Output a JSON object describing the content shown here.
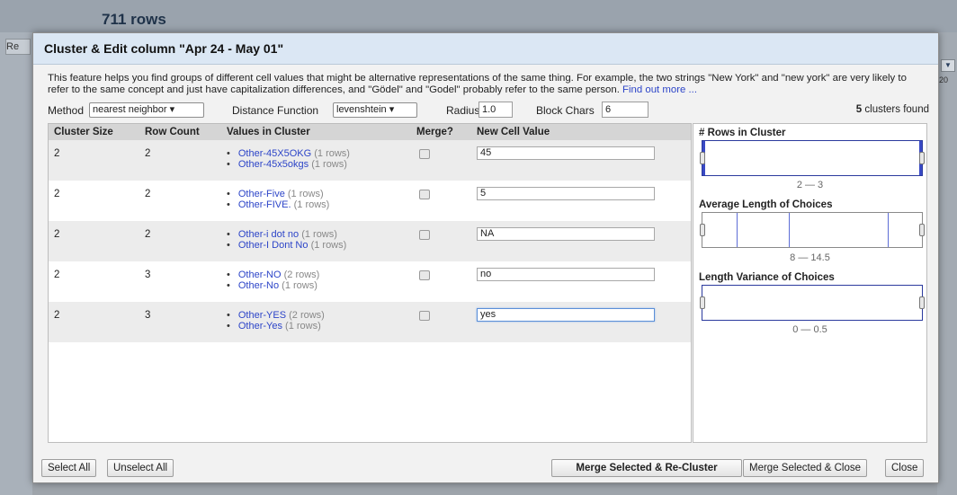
{
  "background": {
    "rows_label": "711 rows",
    "left_button_label": "Re",
    "right_label": "20"
  },
  "dialog": {
    "title": "Cluster & Edit column \"Apr 24 - May 01\"",
    "description": "This feature helps you find groups of different cell values that might be alternative representations of the same thing. For example, the two strings \"New York\" and \"new york\" are very likely to refer to the same concept and just have capitalization differences, and \"Gödel\" and \"Godel\" probably refer to the same person.",
    "find_out_more": "Find out more ...",
    "controls": {
      "method_label": "Method",
      "method_value": "nearest neighbor",
      "distance_label": "Distance Function",
      "distance_value": "levenshtein",
      "radius_label": "Radius",
      "radius_value": "1.0",
      "block_label": "Block Chars",
      "block_value": "6",
      "clusters_count": "5",
      "clusters_found": "clusters found"
    },
    "table": {
      "headers": [
        "Cluster Size",
        "Row Count",
        "Values in Cluster",
        "Merge?",
        "New Cell Value"
      ],
      "rows": [
        {
          "size": "2",
          "count": "2",
          "values": [
            {
              "v": "Other-45X5OKG",
              "rc": "(1 rows)"
            },
            {
              "v": "Other-45x5okgs",
              "rc": "(1 rows)"
            }
          ],
          "merge": false,
          "new_value": "45"
        },
        {
          "size": "2",
          "count": "2",
          "values": [
            {
              "v": "Other-Five",
              "rc": "(1 rows)"
            },
            {
              "v": "Other-FIVE.",
              "rc": "(1 rows)"
            }
          ],
          "merge": false,
          "new_value": "5"
        },
        {
          "size": "2",
          "count": "2",
          "values": [
            {
              "v": "Other-i dot no",
              "rc": "(1 rows)"
            },
            {
              "v": "Other-I Dont No",
              "rc": "(1 rows)"
            }
          ],
          "merge": false,
          "new_value": "NA"
        },
        {
          "size": "2",
          "count": "3",
          "values": [
            {
              "v": "Other-NO",
              "rc": "(2 rows)"
            },
            {
              "v": "Other-No",
              "rc": "(1 rows)"
            }
          ],
          "merge": false,
          "new_value": "no"
        },
        {
          "size": "2",
          "count": "3",
          "values": [
            {
              "v": "Other-YES",
              "rc": "(2 rows)"
            },
            {
              "v": "Other-Yes",
              "rc": "(1 rows)"
            }
          ],
          "merge": false,
          "new_value": "yes"
        }
      ]
    },
    "facets": [
      {
        "title": "# Rows in Cluster",
        "range": "2 — 3"
      },
      {
        "title": "Average Length of Choices",
        "range": "8 — 14.5"
      },
      {
        "title": "Length Variance of Choices",
        "range": "0 — 0.5"
      }
    ],
    "buttons": {
      "select_all": "Select All",
      "unselect_all": "Unselect All",
      "merge_recluster": "Merge Selected & Re-Cluster",
      "merge_close": "Merge Selected & Close",
      "close": "Close"
    }
  },
  "colors": {
    "link": "#2d45c8",
    "header": "#dbe7f4"
  }
}
